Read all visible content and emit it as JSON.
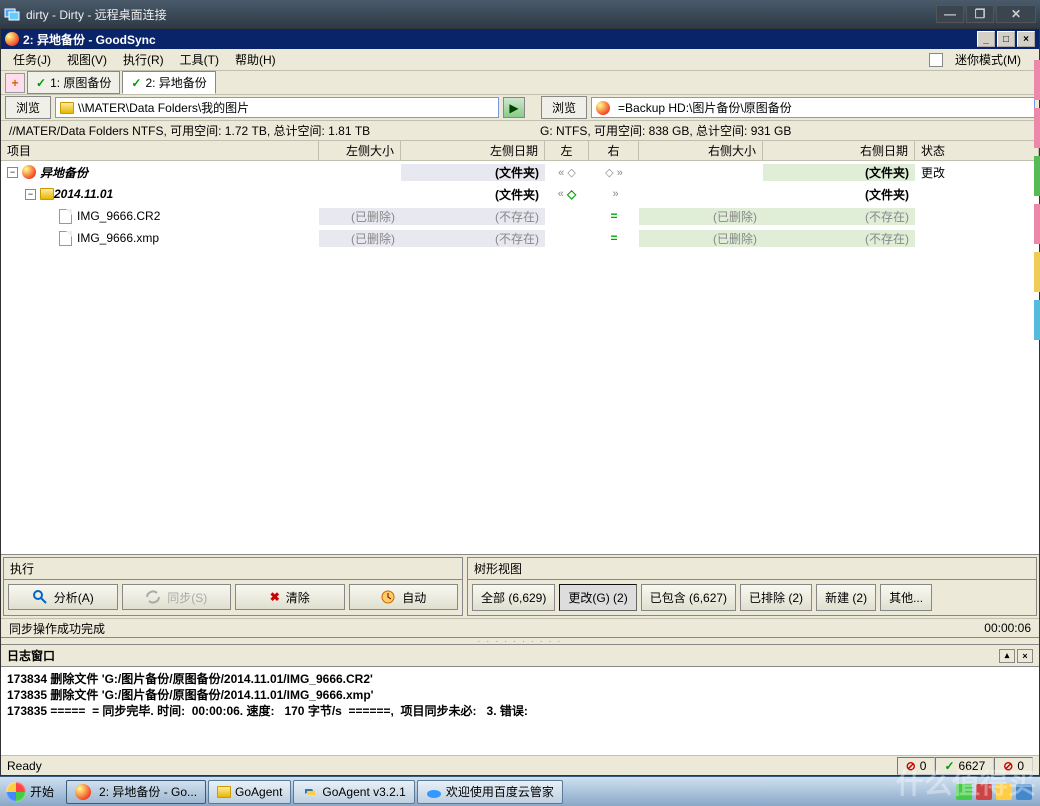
{
  "rdp": {
    "title": "dirty - Dirty - 远程桌面连接"
  },
  "gs": {
    "title": "2: 异地备份 - GoodSync",
    "menu": {
      "task": "任务(J)",
      "view": "视图(V)",
      "run": "执行(R)",
      "tools": "工具(T)",
      "help": "帮助(H)",
      "minimode": "迷你模式(M)"
    },
    "tabs": {
      "t1": "1: 原图备份",
      "t2": "2: 异地备份"
    },
    "browse": "浏览",
    "leftPath": "\\\\MATER\\Data Folders\\我的图片",
    "rightPath": "=Backup HD:\\图片备份\\原图备份",
    "leftSpace": "//MATER/Data Folders NTFS, 可用空间: 1.72 TB, 总计空间: 1.81 TB",
    "rightSpace": "G: NTFS, 可用空间: 838 GB, 总计空间: 931 GB",
    "columns": {
      "item": "项目",
      "lsize": "左侧大小",
      "ldate": "左侧日期",
      "l": "左",
      "r": "右",
      "rsize": "右侧大小",
      "rdate": "右侧日期",
      "status": "状态"
    },
    "rows": {
      "root": {
        "name": "异地备份",
        "ldate": "(文件夹)",
        "rdate": "(文件夹)",
        "status": "更改"
      },
      "folder": {
        "name": "2014.11.01",
        "ldate": "(文件夹)",
        "rdate": "(文件夹)"
      },
      "f1": {
        "name": "IMG_9666.CR2",
        "lsize": "(已删除)",
        "ldate": "(不存在)",
        "rsize": "(已删除)",
        "rdate": "(不存在)"
      },
      "f2": {
        "name": "IMG_9666.xmp",
        "lsize": "(已删除)",
        "ldate": "(不存在)",
        "rsize": "(已删除)",
        "rdate": "(不存在)"
      }
    },
    "exec": {
      "title": "执行",
      "analyze": "分析(A)",
      "sync": "同步(S)",
      "clear": "清除",
      "auto": "自动"
    },
    "tree": {
      "title": "树形视图",
      "all": "全部 (6,629)",
      "changed": "更改(G) (2)",
      "included": "已包含 (6,627)",
      "excluded": "已排除 (2)",
      "new": "新建 (2)",
      "other": "其他..."
    },
    "statusMsg": "同步操作成功完成",
    "elapsed": "00:00:06",
    "log": {
      "title": "日志窗口",
      "l1": "173834 删除文件 'G:/图片备份/原图备份/2014.11.01/IMG_9666.CR2'",
      "l2": "173835 删除文件 'G:/图片备份/原图备份/2014.11.01/IMG_9666.xmp'",
      "l3": "173835 =====  = 同步完毕. 时间:  00:00:06. 速度:   170 字节/s  ======,  项目同步未必:   3. 错误:"
    },
    "ready": "Ready",
    "counters": {
      "c1": "0",
      "c2": "6627",
      "c3": "0"
    }
  },
  "taskbar": {
    "start": "开始",
    "t1": "2: 异地备份 - Go...",
    "t2": "GoAgent",
    "t3": "GoAgent v3.2.1",
    "t4": "欢迎使用百度云管家"
  },
  "watermark": "什么值得买"
}
